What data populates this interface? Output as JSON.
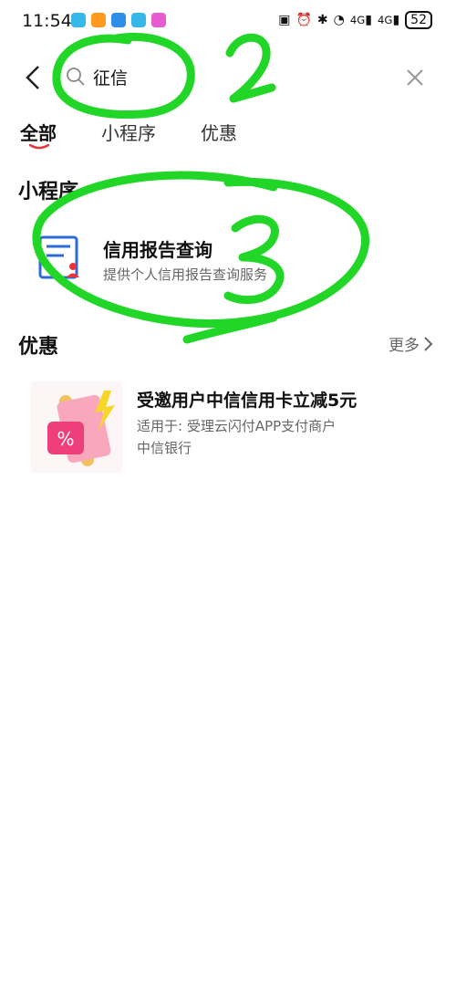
{
  "status_bar": {
    "time": "11:54",
    "battery": "52",
    "network_1": "4G",
    "network_2": "4G"
  },
  "search": {
    "query": "征信"
  },
  "tabs": [
    {
      "label": "全部"
    },
    {
      "label": "小程序"
    },
    {
      "label": "优惠"
    }
  ],
  "mini_programs": {
    "title": "小程序",
    "item": {
      "name": "信用报告查询",
      "description": "提供个人信用报告查询服务"
    }
  },
  "offers": {
    "title": "优惠",
    "more_label": "更多",
    "item": {
      "title": "受邀用户中信信用卡立减5元",
      "applies": "适用于: 受理云闪付APP支付商户",
      "bank": "中信银行"
    }
  },
  "annotations": {
    "mark_2": "2",
    "mark_3": "3"
  },
  "colors": {
    "accent_red": "#e8333a",
    "annotation_green": "#22d628",
    "icon_blue": "#2d6bd6"
  }
}
